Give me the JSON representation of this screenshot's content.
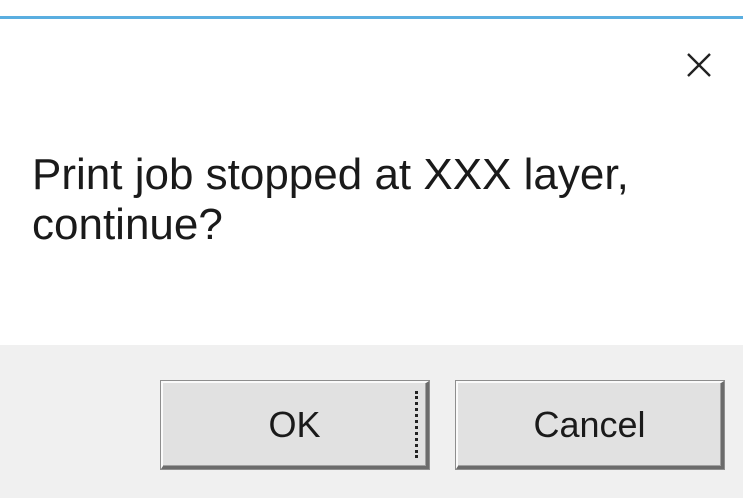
{
  "dialog": {
    "message": "Print job stopped at XXX layer, continue?",
    "close_icon": "close-icon",
    "accent_color": "#5aaee0"
  },
  "buttons": {
    "ok_label": "OK",
    "cancel_label": "Cancel"
  }
}
